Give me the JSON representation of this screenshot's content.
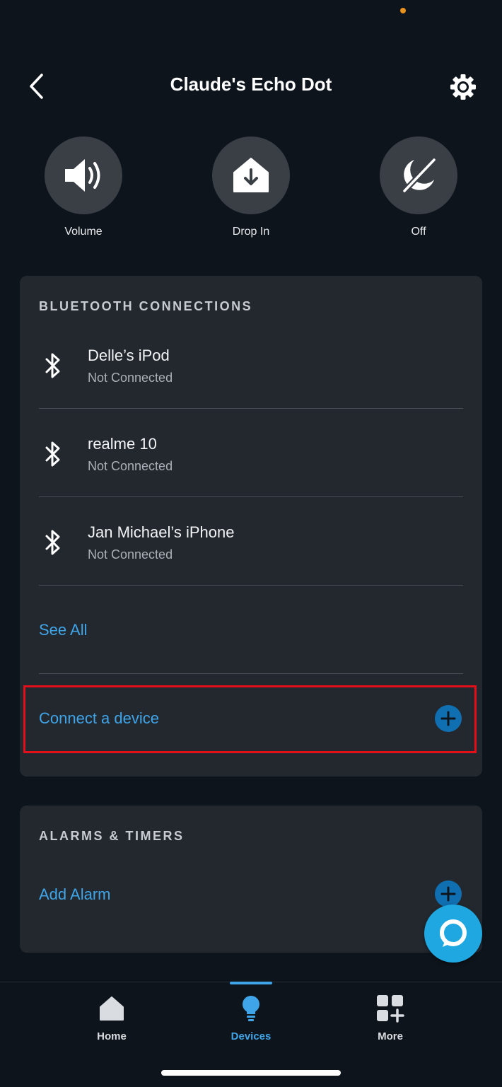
{
  "header": {
    "title": "Claude's Echo Dot"
  },
  "quick_actions": [
    {
      "label": "Volume",
      "icon": "speaker-icon"
    },
    {
      "label": "Drop In",
      "icon": "drop-in-icon"
    },
    {
      "label": "Off",
      "icon": "do-not-disturb-icon"
    }
  ],
  "bluetooth": {
    "title": "BLUETOOTH CONNECTIONS",
    "devices": [
      {
        "name": "Delle’s iPod",
        "status": "Not Connected"
      },
      {
        "name": "realme 10",
        "status": "Not Connected"
      },
      {
        "name": "Jan Michael’s iPhone",
        "status": "Not Connected"
      }
    ],
    "see_all": "See All",
    "connect": "Connect a device"
  },
  "alarms": {
    "title": "ALARMS & TIMERS",
    "add_alarm": "Add Alarm"
  },
  "nav": {
    "items": [
      {
        "label": "Home",
        "icon": "home-icon"
      },
      {
        "label": "Devices",
        "icon": "lightbulb-icon"
      },
      {
        "label": "More",
        "icon": "more-grid-icon"
      }
    ]
  },
  "colors": {
    "background": "#0e141b",
    "card": "#23282f",
    "accent": "#3fa5e8",
    "highlight": "#e3101b",
    "alexa": "#1ea7e0"
  }
}
